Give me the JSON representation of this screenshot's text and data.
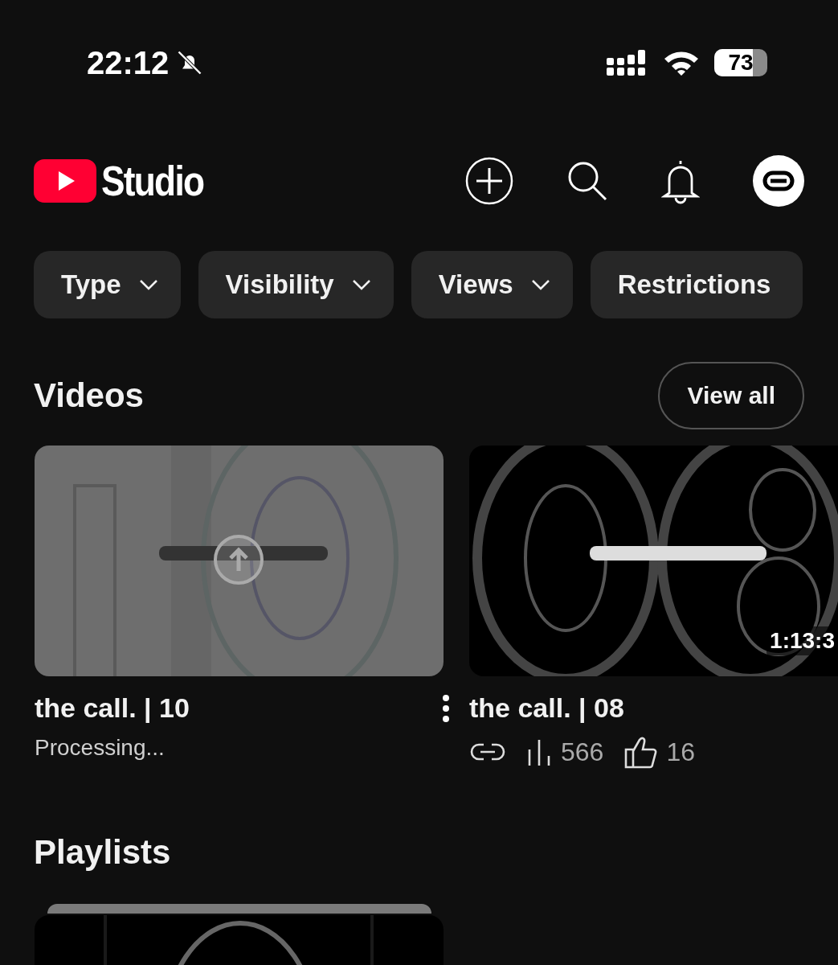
{
  "status_bar": {
    "time": "22:12",
    "battery": "73"
  },
  "header": {
    "logo_text": "Studio"
  },
  "filters": [
    {
      "label": "Type",
      "chevron": true
    },
    {
      "label": "Visibility",
      "chevron": true
    },
    {
      "label": "Views",
      "chevron": true
    },
    {
      "label": "Restrictions",
      "chevron": false
    }
  ],
  "videos_section": {
    "title": "Videos",
    "action": "View all"
  },
  "videos": [
    {
      "kind": "processing",
      "title": "the call. | 10",
      "status": "Processing..."
    },
    {
      "kind": "published",
      "title": "the call. | 08",
      "duration": "1:13:3",
      "views": "566",
      "likes": "16"
    }
  ],
  "playlists_section": {
    "title": "Playlists"
  }
}
